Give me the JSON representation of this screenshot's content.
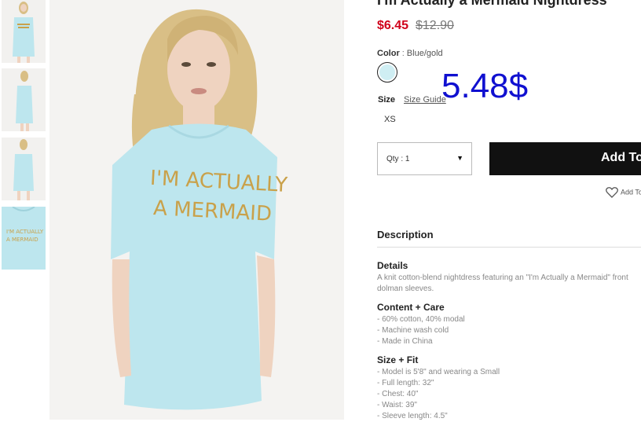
{
  "product": {
    "title": "I'm Actually a Mermaid Nightdress",
    "sale_price": "$6.45",
    "original_price": "$12.90"
  },
  "color": {
    "label": "Color",
    "separator": ":",
    "value": "Blue/gold",
    "swatch_hex": "#cfeef3"
  },
  "size": {
    "label": "Size",
    "guide_label": "Size Guide",
    "options": [
      "XS"
    ]
  },
  "annotation": {
    "text": "5.48$",
    "color": "#1010d0"
  },
  "quantity": {
    "label": "Qty : 1"
  },
  "cart": {
    "add_label": "Add To Bag"
  },
  "wishlist": {
    "label": "Add To Wishlist"
  },
  "shirt_print": {
    "line1": "I'M ACTUALLY",
    "line2": "A MERMAID"
  },
  "description": {
    "heading": "Description",
    "details_title": "Details",
    "details_lines": [
      "A knit cotton-blend nightdress featuring an \"I'm Actually a Mermaid\" front",
      "dolman sleeves."
    ],
    "care_title": "Content + Care",
    "care_lines": [
      "- 60% cotton, 40% modal",
      "- Machine wash cold",
      "- Made in China"
    ],
    "fit_title": "Size + Fit",
    "fit_lines": [
      "- Model is 5'8\" and wearing a Small",
      "- Full length: 32\"",
      "- Chest: 40\"",
      "- Waist: 39\"",
      "- Sleeve length: 4.5\""
    ]
  },
  "colors": {
    "dress": "#bde6ee",
    "hair": "#d9bf86",
    "skin": "#efd3c0",
    "print": "#c9a14a",
    "sale": "#d0021b"
  }
}
